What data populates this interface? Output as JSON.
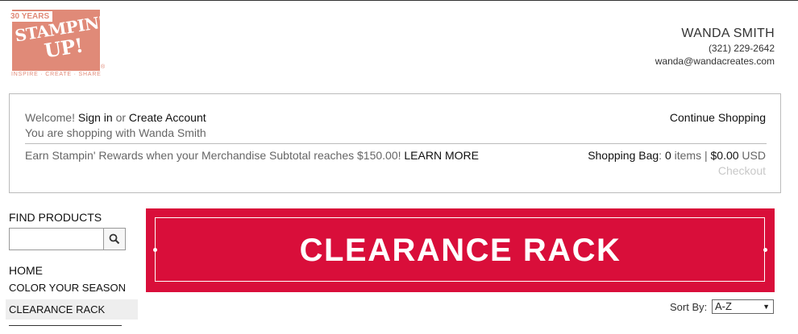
{
  "logo": {
    "years": "30 YEARS",
    "word1": "STAMPIN'",
    "word2": "UP!",
    "tagline": "INSPIRE · CREATE · SHARE",
    "reg": "®",
    "color": "#e08a78"
  },
  "contact": {
    "name": "WANDA SMITH",
    "phone": "(321) 229-2642",
    "email": "wanda@wandacreates.com"
  },
  "account": {
    "welcome_prefix": "Welcome! ",
    "sign_in": "Sign in",
    "or": " or ",
    "create_account": "Create Account",
    "shopping_with": "You are shopping with Wanda Smith",
    "continue_shopping": "Continue Shopping",
    "rewards_text": "Earn Stampin' Rewards when your Merchandise Subtotal reaches $150.00! ",
    "learn_more": "LEARN MORE",
    "bag_label": "Shopping Bag",
    "bag_colon": ": ",
    "bag_count": "0",
    "bag_items": " items | ",
    "bag_total": "$0.00",
    "bag_currency": " USD",
    "checkout": "Checkout"
  },
  "sidebar": {
    "find_title": "FIND PRODUCTS",
    "search_value": "",
    "search_icon": "search-icon",
    "home": "HOME",
    "items": [
      {
        "label": "COLOR YOUR SEASON"
      },
      {
        "label": "CLEARANCE RACK",
        "active": true
      }
    ]
  },
  "banner": {
    "title": "CLEARANCE RACK",
    "color": "#d90e3a"
  },
  "sort": {
    "label": "Sort By:",
    "selected": "A-Z"
  }
}
